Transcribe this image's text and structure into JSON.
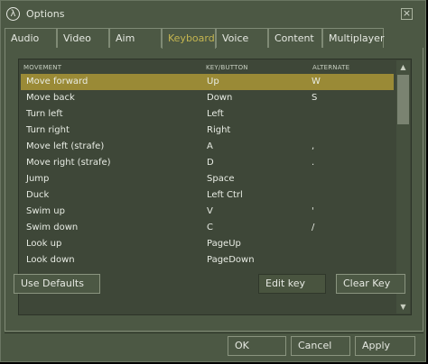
{
  "window": {
    "title": "Options",
    "logo_glyph": "λ",
    "close_glyph": "×"
  },
  "tabs": [
    {
      "label": "Audio"
    },
    {
      "label": "Video"
    },
    {
      "label": "Aim"
    },
    {
      "label": "Keyboard",
      "active": true
    },
    {
      "label": "Voice"
    },
    {
      "label": "Content"
    },
    {
      "label": "Multiplayer"
    }
  ],
  "keylist": {
    "headers": {
      "action": "MOVEMENT",
      "key": "KEY/BUTTON",
      "alternate": "ALTERNATE"
    },
    "rows": [
      {
        "action": "Move forward",
        "key": "Up",
        "alternate": "W",
        "selected": true
      },
      {
        "action": "Move back",
        "key": "Down",
        "alternate": "S"
      },
      {
        "action": "Turn left",
        "key": "Left",
        "alternate": ""
      },
      {
        "action": "Turn right",
        "key": "Right",
        "alternate": ""
      },
      {
        "action": "Move left (strafe)",
        "key": "A",
        "alternate": ","
      },
      {
        "action": "Move right (strafe)",
        "key": "D",
        "alternate": "."
      },
      {
        "action": "Jump",
        "key": "Space",
        "alternate": ""
      },
      {
        "action": "Duck",
        "key": "Left Ctrl",
        "alternate": ""
      },
      {
        "action": "Swim up",
        "key": "V",
        "alternate": "'"
      },
      {
        "action": "Swim down",
        "key": "C",
        "alternate": "/"
      },
      {
        "action": "Look up",
        "key": "PageUp",
        "alternate": ""
      },
      {
        "action": "Look down",
        "key": "PageDown",
        "alternate": ""
      }
    ],
    "scroll_up_glyph": "▲",
    "scroll_down_glyph": "▼"
  },
  "buttons": {
    "use_defaults": "Use Defaults",
    "edit_key": "Edit key",
    "clear_key": "Clear Key",
    "ok": "OK",
    "cancel": "Cancel",
    "apply": "Apply"
  },
  "colors": {
    "background": "#4c5844",
    "selection": "#9a8a36",
    "active_tab_text": "#c4b550"
  }
}
